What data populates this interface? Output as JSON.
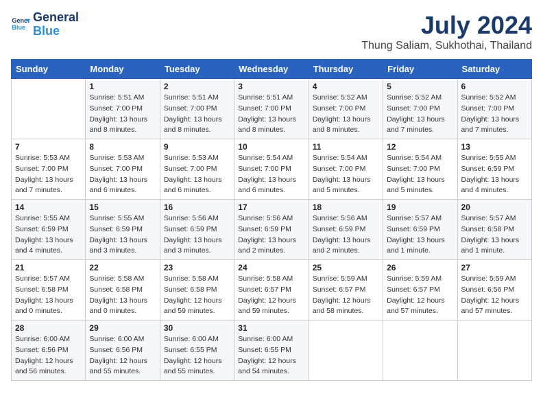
{
  "header": {
    "logo_line1": "General",
    "logo_line2": "Blue",
    "title": "July 2024",
    "subtitle": "Thung Saliam, Sukhothai, Thailand"
  },
  "calendar": {
    "days_of_week": [
      "Sunday",
      "Monday",
      "Tuesday",
      "Wednesday",
      "Thursday",
      "Friday",
      "Saturday"
    ],
    "weeks": [
      [
        {
          "day": "",
          "info": ""
        },
        {
          "day": "1",
          "info": "Sunrise: 5:51 AM\nSunset: 7:00 PM\nDaylight: 13 hours and 8 minutes."
        },
        {
          "day": "2",
          "info": "Sunrise: 5:51 AM\nSunset: 7:00 PM\nDaylight: 13 hours and 8 minutes."
        },
        {
          "day": "3",
          "info": "Sunrise: 5:51 AM\nSunset: 7:00 PM\nDaylight: 13 hours and 8 minutes."
        },
        {
          "day": "4",
          "info": "Sunrise: 5:52 AM\nSunset: 7:00 PM\nDaylight: 13 hours and 8 minutes."
        },
        {
          "day": "5",
          "info": "Sunrise: 5:52 AM\nSunset: 7:00 PM\nDaylight: 13 hours and 7 minutes."
        },
        {
          "day": "6",
          "info": "Sunrise: 5:52 AM\nSunset: 7:00 PM\nDaylight: 13 hours and 7 minutes."
        }
      ],
      [
        {
          "day": "7",
          "info": "Sunrise: 5:53 AM\nSunset: 7:00 PM\nDaylight: 13 hours and 7 minutes."
        },
        {
          "day": "8",
          "info": "Sunrise: 5:53 AM\nSunset: 7:00 PM\nDaylight: 13 hours and 6 minutes."
        },
        {
          "day": "9",
          "info": "Sunrise: 5:53 AM\nSunset: 7:00 PM\nDaylight: 13 hours and 6 minutes."
        },
        {
          "day": "10",
          "info": "Sunrise: 5:54 AM\nSunset: 7:00 PM\nDaylight: 13 hours and 6 minutes."
        },
        {
          "day": "11",
          "info": "Sunrise: 5:54 AM\nSunset: 7:00 PM\nDaylight: 13 hours and 5 minutes."
        },
        {
          "day": "12",
          "info": "Sunrise: 5:54 AM\nSunset: 7:00 PM\nDaylight: 13 hours and 5 minutes."
        },
        {
          "day": "13",
          "info": "Sunrise: 5:55 AM\nSunset: 6:59 PM\nDaylight: 13 hours and 4 minutes."
        }
      ],
      [
        {
          "day": "14",
          "info": "Sunrise: 5:55 AM\nSunset: 6:59 PM\nDaylight: 13 hours and 4 minutes."
        },
        {
          "day": "15",
          "info": "Sunrise: 5:55 AM\nSunset: 6:59 PM\nDaylight: 13 hours and 3 minutes."
        },
        {
          "day": "16",
          "info": "Sunrise: 5:56 AM\nSunset: 6:59 PM\nDaylight: 13 hours and 3 minutes."
        },
        {
          "day": "17",
          "info": "Sunrise: 5:56 AM\nSunset: 6:59 PM\nDaylight: 13 hours and 2 minutes."
        },
        {
          "day": "18",
          "info": "Sunrise: 5:56 AM\nSunset: 6:59 PM\nDaylight: 13 hours and 2 minutes."
        },
        {
          "day": "19",
          "info": "Sunrise: 5:57 AM\nSunset: 6:59 PM\nDaylight: 13 hours and 1 minute."
        },
        {
          "day": "20",
          "info": "Sunrise: 5:57 AM\nSunset: 6:58 PM\nDaylight: 13 hours and 1 minute."
        }
      ],
      [
        {
          "day": "21",
          "info": "Sunrise: 5:57 AM\nSunset: 6:58 PM\nDaylight: 13 hours and 0 minutes."
        },
        {
          "day": "22",
          "info": "Sunrise: 5:58 AM\nSunset: 6:58 PM\nDaylight: 13 hours and 0 minutes."
        },
        {
          "day": "23",
          "info": "Sunrise: 5:58 AM\nSunset: 6:58 PM\nDaylight: 12 hours and 59 minutes."
        },
        {
          "day": "24",
          "info": "Sunrise: 5:58 AM\nSunset: 6:57 PM\nDaylight: 12 hours and 59 minutes."
        },
        {
          "day": "25",
          "info": "Sunrise: 5:59 AM\nSunset: 6:57 PM\nDaylight: 12 hours and 58 minutes."
        },
        {
          "day": "26",
          "info": "Sunrise: 5:59 AM\nSunset: 6:57 PM\nDaylight: 12 hours and 57 minutes."
        },
        {
          "day": "27",
          "info": "Sunrise: 5:59 AM\nSunset: 6:56 PM\nDaylight: 12 hours and 57 minutes."
        }
      ],
      [
        {
          "day": "28",
          "info": "Sunrise: 6:00 AM\nSunset: 6:56 PM\nDaylight: 12 hours and 56 minutes."
        },
        {
          "day": "29",
          "info": "Sunrise: 6:00 AM\nSunset: 6:56 PM\nDaylight: 12 hours and 55 minutes."
        },
        {
          "day": "30",
          "info": "Sunrise: 6:00 AM\nSunset: 6:55 PM\nDaylight: 12 hours and 55 minutes."
        },
        {
          "day": "31",
          "info": "Sunrise: 6:00 AM\nSunset: 6:55 PM\nDaylight: 12 hours and 54 minutes."
        },
        {
          "day": "",
          "info": ""
        },
        {
          "day": "",
          "info": ""
        },
        {
          "day": "",
          "info": ""
        }
      ]
    ]
  }
}
